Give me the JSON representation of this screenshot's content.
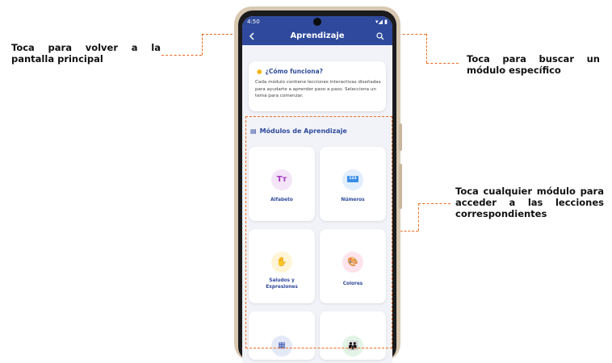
{
  "annotations": {
    "back": "Toca para volver a la pantalla principal",
    "search": "Toca para buscar un módulo específico",
    "modules": "Toca cualquier módulo para acceder a las lecciones correspondientes"
  },
  "status_bar": {
    "time": "4:50",
    "icons": "▾◢ ▮"
  },
  "app_bar": {
    "title": "Aprendizaje"
  },
  "info_card": {
    "title": "¿Cómo funciona?",
    "text": "Cada módulo contiene lecciones interactivas diseñadas para ayudarte a aprender paso a paso. Selecciona un tema para comenzar."
  },
  "section": {
    "title": "Módulos de Aprendizaje"
  },
  "modules": [
    {
      "label": "Alfabeto",
      "icon": "Tт",
      "icon_name": "text-icon",
      "color": "#a83ac2",
      "bg": "#f4e5f8"
    },
    {
      "label": "Números",
      "icon": "123",
      "icon_name": "numbers-icon",
      "color": "#ffffff",
      "bg": "#e2eefc"
    },
    {
      "label": "Saludos y Expresiones",
      "icon": "✋",
      "icon_name": "hand-wave-icon",
      "color": "#f0a800",
      "bg": "#fff4d6"
    },
    {
      "label": "Colores",
      "icon": "🎨",
      "icon_name": "palette-icon",
      "color": "#e0306a",
      "bg": "#fde4ec"
    },
    {
      "label": "",
      "icon": "▦",
      "icon_name": "calendar-icon",
      "color": "#3a56b0",
      "bg": "#e4e9f8"
    },
    {
      "label": "",
      "icon": "👪",
      "icon_name": "family-icon",
      "color": "#2e9a48",
      "bg": "#e2f4e6"
    }
  ],
  "colors": {
    "primary": "#2f4a9c",
    "annotation": "#ec6a1f"
  }
}
